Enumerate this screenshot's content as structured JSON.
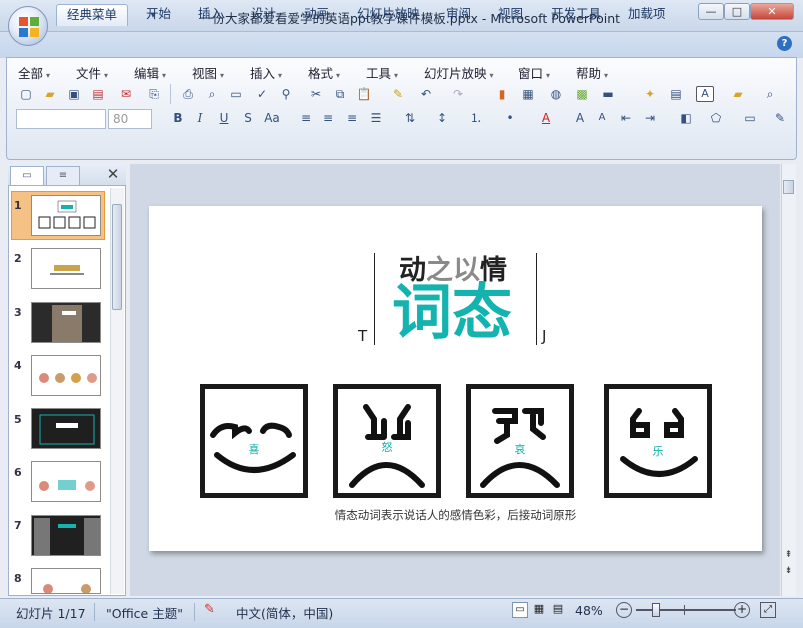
{
  "window": {
    "title": "一份大家都爱看爱学的英语ppt教学课件模板.pptx - Microsoft PowerPoint",
    "min": "—",
    "max": "□",
    "close": "✕"
  },
  "ribbon_tabs": [
    "经典菜单",
    "开始",
    "插入",
    "设计",
    "动画",
    "幻灯片放映",
    "审阅",
    "视图",
    "开发工具",
    "加载项"
  ],
  "help": "?",
  "classic_menus": [
    "全部",
    "文件",
    "编辑",
    "视图",
    "插入",
    "格式",
    "工具",
    "幻灯片放映",
    "窗口",
    "帮助"
  ],
  "font": {
    "name": "",
    "size": "80"
  },
  "panel": {
    "close": "✕"
  },
  "thumbs": [
    "1",
    "2",
    "3",
    "4",
    "5",
    "6",
    "7",
    "8"
  ],
  "slide": {
    "heading_top_dark": "动",
    "heading_top_gray": "之以",
    "heading_top_dark2": "情",
    "heading_main": "词态",
    "bracket_left": "T",
    "bracket_right": "J",
    "faces": [
      {
        "label": "喜",
        "mood": "happy"
      },
      {
        "label": "怒",
        "mood": "angry"
      },
      {
        "label": "哀",
        "mood": "sad"
      },
      {
        "label": "乐",
        "mood": "joy"
      }
    ],
    "caption": "情态动词表示说话人的感情色彩，后接动词原形",
    "accent": "#14b3b0"
  },
  "status": {
    "slide_indicator": "幻灯片 1/17",
    "theme": "\"Office 主题\"",
    "language": "中文(简体，中国)",
    "zoom": "48%"
  }
}
